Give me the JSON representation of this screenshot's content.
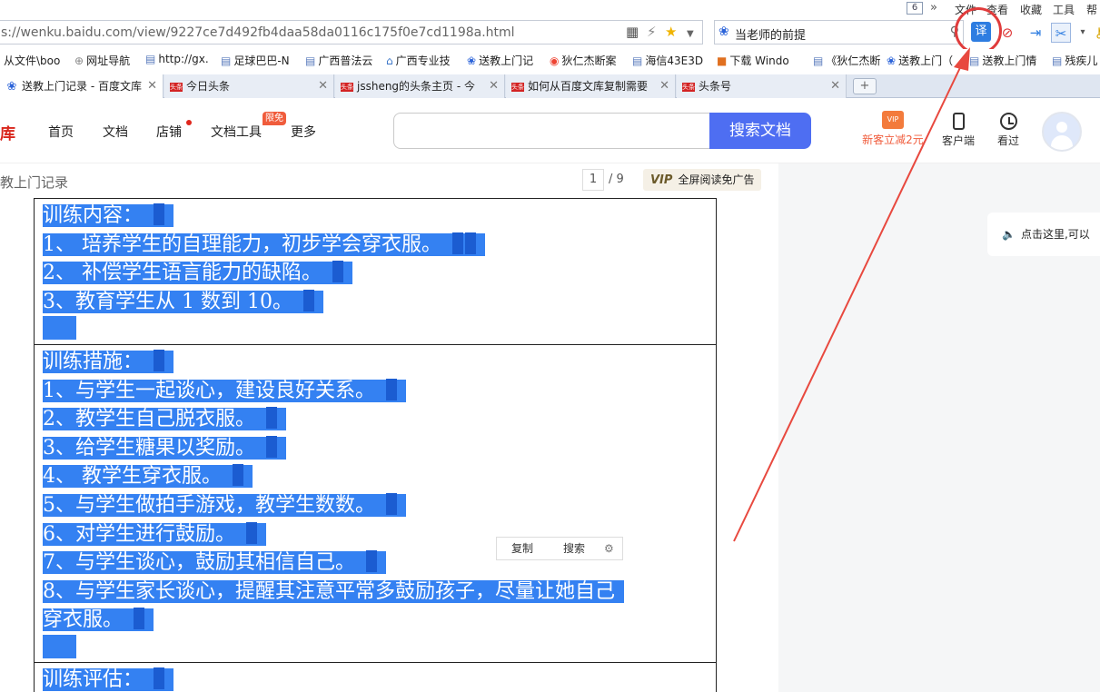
{
  "menubar": {
    "tab_count": "6",
    "chevron": "»",
    "items": [
      "文件",
      "查看",
      "收藏",
      "工具",
      "帮"
    ]
  },
  "address": {
    "url": "s://wenku.baidu.com/view/9227ce7d492fb4daa58da0116c175f0e7cd1198a.html"
  },
  "search": {
    "query": "当老师的前提"
  },
  "bookmarks": [
    "从文件\\boo",
    "网址导航",
    "http://gx.",
    "足球巴巴-N",
    "广西普法云",
    "广西专业技",
    "送教上门记",
    "狄仁杰断案",
    "海信43E3D",
    "下载 Windo",
    "《狄仁杰断",
    "送教上门（",
    "送教上门情",
    "残疾儿"
  ],
  "tabs": [
    {
      "label": "送教上门记录 - 百度文库",
      "active": true
    },
    {
      "label": "今日头条",
      "active": false
    },
    {
      "label": "jssheng的头条主页 - 今",
      "active": false
    },
    {
      "label": "如何从百度文库复制需要",
      "active": false
    },
    {
      "label": "头条号",
      "active": false
    }
  ],
  "tab_favicon": "头条",
  "site": {
    "logo_fragment": "库",
    "nav": [
      "首页",
      "文档",
      "店铺",
      "文档工具",
      "更多"
    ],
    "free_badge": "限免",
    "search_button": "搜索文档",
    "promo": "新客立减2元",
    "client": "客户端",
    "history": "看过"
  },
  "doc": {
    "title": "教上门记录",
    "page_current": "1",
    "page_total": "/ 9",
    "vip_text": "全屏阅读免广告"
  },
  "notice": "点击这里,可以",
  "sections": [
    {
      "lines": [
        "训练内容：",
        "1、 培养学生的自理能力，初步学会穿衣服。",
        "2、 补偿学生语言能力的缺陷。",
        "3、教育学生从 1 数到 10。"
      ]
    },
    {
      "lines": [
        "训练措施：",
        "1、与学生一起谈心，建设良好关系。",
        "2、教学生自己脱衣服。",
        "3、给学生糖果以奖励。",
        "4、 教学生穿衣服。",
        "5、与学生做拍手游戏，教学生数数。",
        "6、对学生进行鼓励。",
        "7、与学生谈心，鼓励其相信自己。",
        "8、与学生家长谈心，提醒其注意平常多鼓励孩子，尽量让她自己",
        "穿衣服。"
      ]
    },
    {
      "lines": [
        "训练评估："
      ]
    }
  ],
  "float_toolbar": {
    "copy": "复制",
    "search": "搜索"
  }
}
